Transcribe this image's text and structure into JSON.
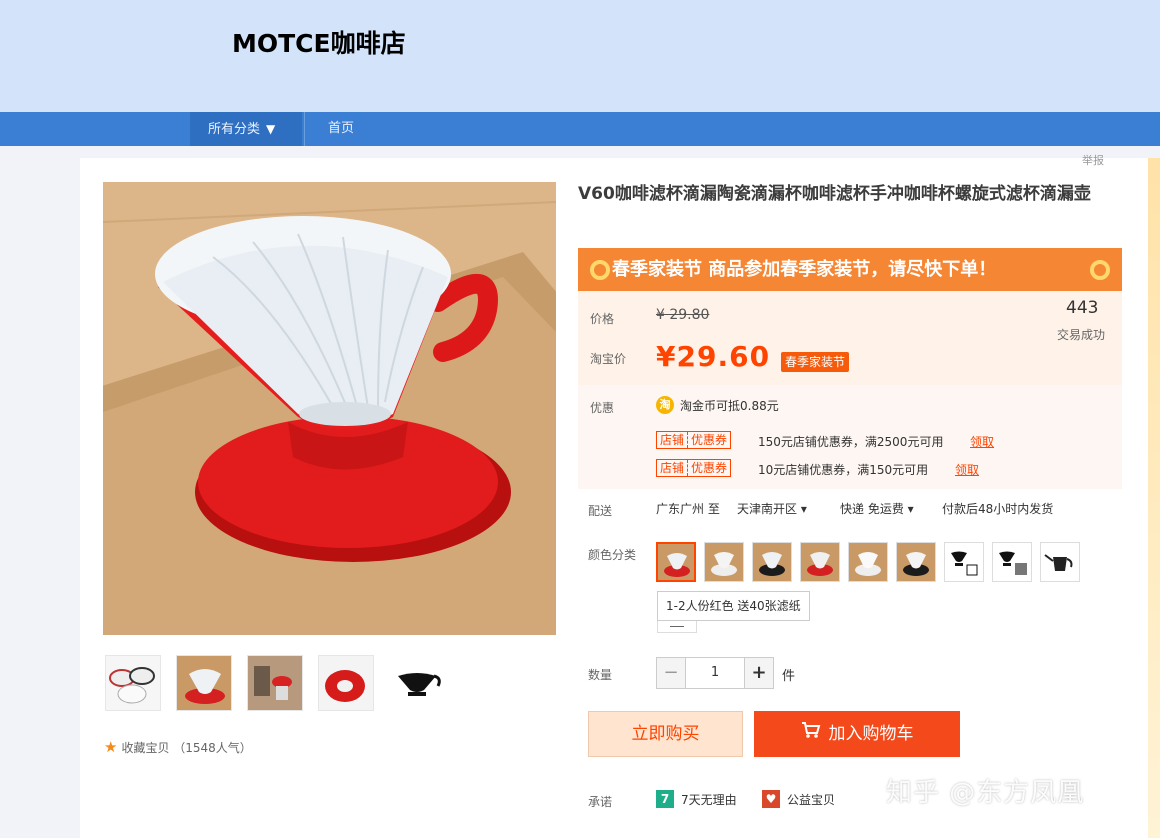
{
  "header": {
    "shop_name": "MOTCE咖啡店"
  },
  "nav": {
    "all_categories": "所有分类",
    "home": "首页"
  },
  "product": {
    "title": "V60咖啡滤杯滴漏陶瓷滴漏杯咖啡滤杯手冲咖啡杯螺旋式滤杯滴漏壶",
    "top_tag": "举报",
    "banner": "春季家装节 商品参加春季家装节，请尽快下单！",
    "price_label": "价格",
    "original_price": "¥ 29.80",
    "taobao_price_label": "淘宝价",
    "current_price": "¥29.60",
    "price_tag": "春季家装节",
    "sales_count": "443",
    "sales_label": "交易成功",
    "promo_label": "优惠",
    "coin_text": "淘金币可抵0.88元",
    "coupons": [
      {
        "badge_a": "店铺",
        "badge_b": "优惠券",
        "text": "150元店铺优惠券，满2500元可用",
        "action": "领取"
      },
      {
        "badge_a": "店铺",
        "badge_b": "优惠券",
        "text": "10元店铺优惠券，满150元可用",
        "action": "领取"
      }
    ],
    "shipping_label": "配送",
    "ship_from": "广东广州 至",
    "ship_to": "天津南开区",
    "ship_method": "快递 免运费",
    "ship_time": "付款后48小时内发货",
    "color_label": "颜色分类",
    "selected_color": "1-2人份红色 送40张滤纸",
    "quantity_label": "数量",
    "quantity": "1",
    "quantity_unit": "件",
    "buy_now": "立即购买",
    "add_to_cart": "加入购物车",
    "favorite": "收藏宝贝 （1548人气）",
    "promise_label": "承诺",
    "promises": [
      "7天无理由",
      "公益宝贝"
    ]
  },
  "watermark": "知乎 @东方凤凰",
  "colors": {
    "nav_bar": "#3b7fd4",
    "header_bg": "#d3e3fa",
    "accent": "#ff4400",
    "banner": "#f58634"
  }
}
